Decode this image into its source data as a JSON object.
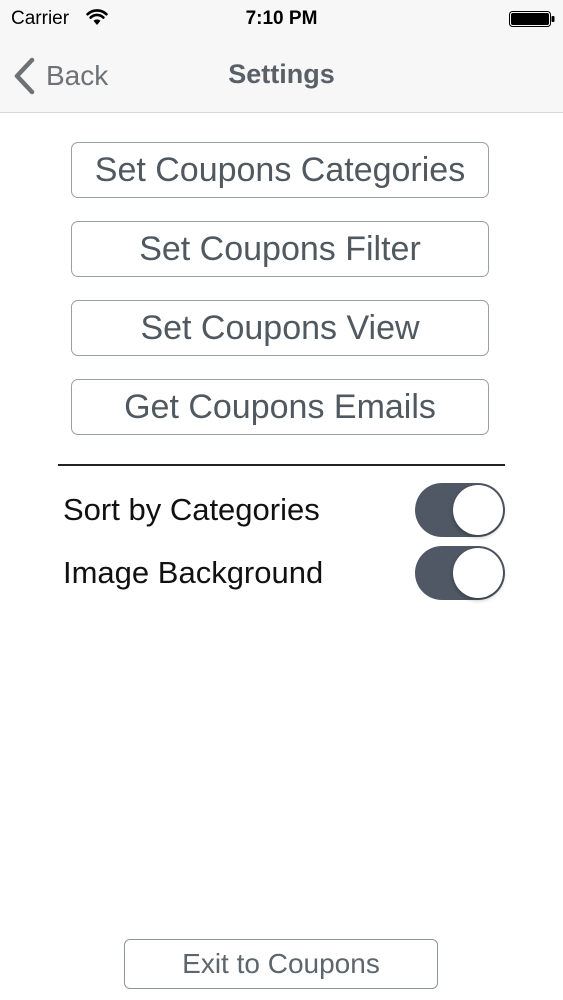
{
  "status_bar": {
    "carrier": "Carrier",
    "time": "7:10 PM",
    "wifi_icon": "wifi-icon",
    "battery_icon": "battery-icon"
  },
  "nav": {
    "back_label": "Back",
    "title": "Settings",
    "back_icon": "chevron-left-icon"
  },
  "actions": [
    {
      "label": "Set Coupons Categories"
    },
    {
      "label": "Set Coupons Filter"
    },
    {
      "label": "Set Coupons View"
    },
    {
      "label": "Get Coupons Emails"
    }
  ],
  "toggles": [
    {
      "label": "Sort by Categories",
      "on": true
    },
    {
      "label": "Image Background",
      "on": true
    }
  ],
  "footer": {
    "exit_label": "Exit to Coupons"
  },
  "colors": {
    "toggle_on": "#4f5864",
    "button_text": "#505860",
    "button_border": "#9a9fa4"
  }
}
